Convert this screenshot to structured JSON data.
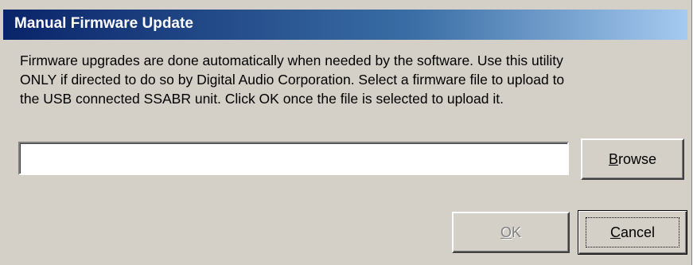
{
  "window": {
    "title": "Manual Firmware Update"
  },
  "message": {
    "lines": [
      "Firmware upgrades are done automatically when needed by the software.  Use this utility",
      "ONLY if directed to do so by Digital Audio Corporation.  Select a firmware file to upload to",
      "the USB connected SSABR unit.  Click OK once the file is selected to upload it."
    ]
  },
  "file_field": {
    "value": ""
  },
  "buttons": {
    "browse": {
      "accel": "B",
      "rest": "rowse",
      "enabled": true
    },
    "ok": {
      "accel": "O",
      "rest": "K",
      "enabled": false
    },
    "cancel": {
      "accel": "C",
      "rest": "ancel",
      "enabled": true,
      "default": true
    }
  }
}
